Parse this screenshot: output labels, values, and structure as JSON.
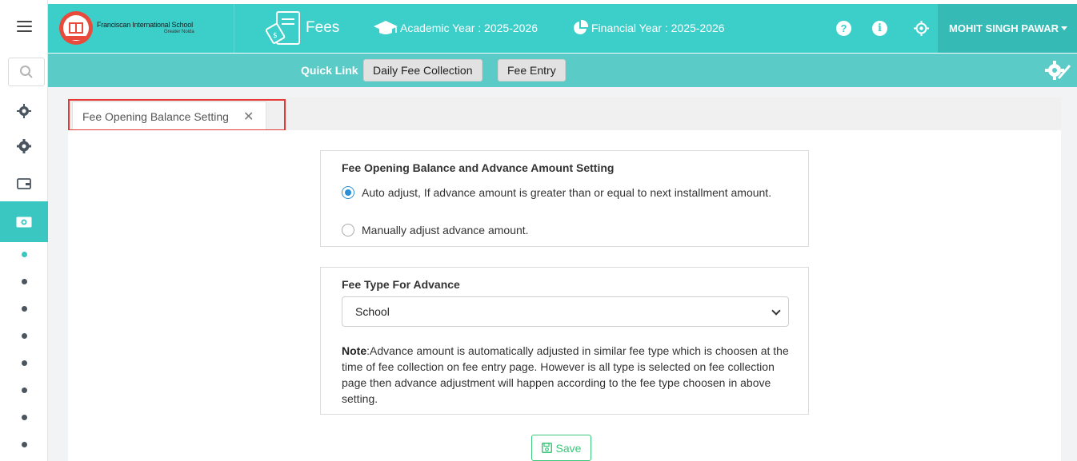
{
  "school": {
    "name": "Franciscan International School",
    "location": "Greater Noida"
  },
  "header": {
    "module": "Fees",
    "academic_year": "Academic Year : 2025-2026",
    "financial_year": "Financial Year : 2025-2026",
    "user": "MOHIT SINGH PAWAR"
  },
  "quicklink": {
    "label": "Quick Link",
    "buttons": [
      "Daily Fee Collection",
      "Fee Entry"
    ]
  },
  "tab": {
    "label": "Fee Opening Balance Setting"
  },
  "balance_card": {
    "title": "Fee Opening Balance and Advance Amount Setting",
    "option_auto": "Auto adjust, If advance amount is greater than or equal to next installment amount.",
    "option_manual": "Manually adjust advance amount.",
    "selected": "auto"
  },
  "fee_type_card": {
    "title": "Fee Type For Advance",
    "selected_value": "School",
    "note_label": "Note",
    "note_text": ":Advance amount is automatically adjusted in similar fee type which is choosen at the time of fee collection on fee entry page. However is all type is selected on fee collection page then advance adjustment will happen according to the fee type choosen in above setting."
  },
  "save_label": "Save",
  "colors": {
    "teal": "#3ccfca",
    "teal_dark": "#35bab5",
    "quickbar": "#5bcbc7",
    "highlight": "#e53935",
    "save": "#3cc77a"
  }
}
